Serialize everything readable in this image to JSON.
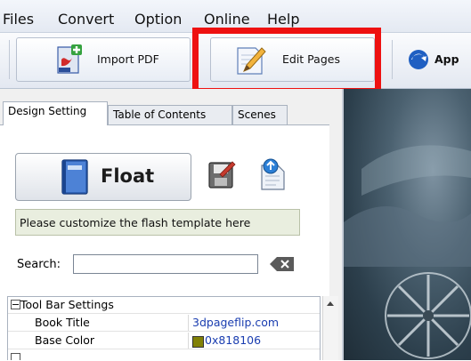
{
  "menu": {
    "items": [
      "Files",
      "Convert",
      "Option",
      "Online",
      "Help"
    ]
  },
  "toolbar": {
    "import_pdf_label": "Import PDF",
    "edit_pages_label": "Edit Pages",
    "apply_label": "App"
  },
  "tabs": [
    "Design Setting",
    "Table of Contents",
    "Scenes"
  ],
  "design": {
    "float_label": "Float",
    "customize_text": "Please customize the flash template here",
    "search_label": "Search:",
    "search_value": ""
  },
  "properties": {
    "group": "Tool Bar Settings",
    "rows": [
      {
        "name": "Book Title",
        "value": "3dpageflip.com"
      },
      {
        "name": "Base Color",
        "value": "0x818106",
        "swatch": "#818106"
      }
    ]
  },
  "colors": {
    "highlight": "#ee1111",
    "base_color_swatch": "#818106"
  }
}
